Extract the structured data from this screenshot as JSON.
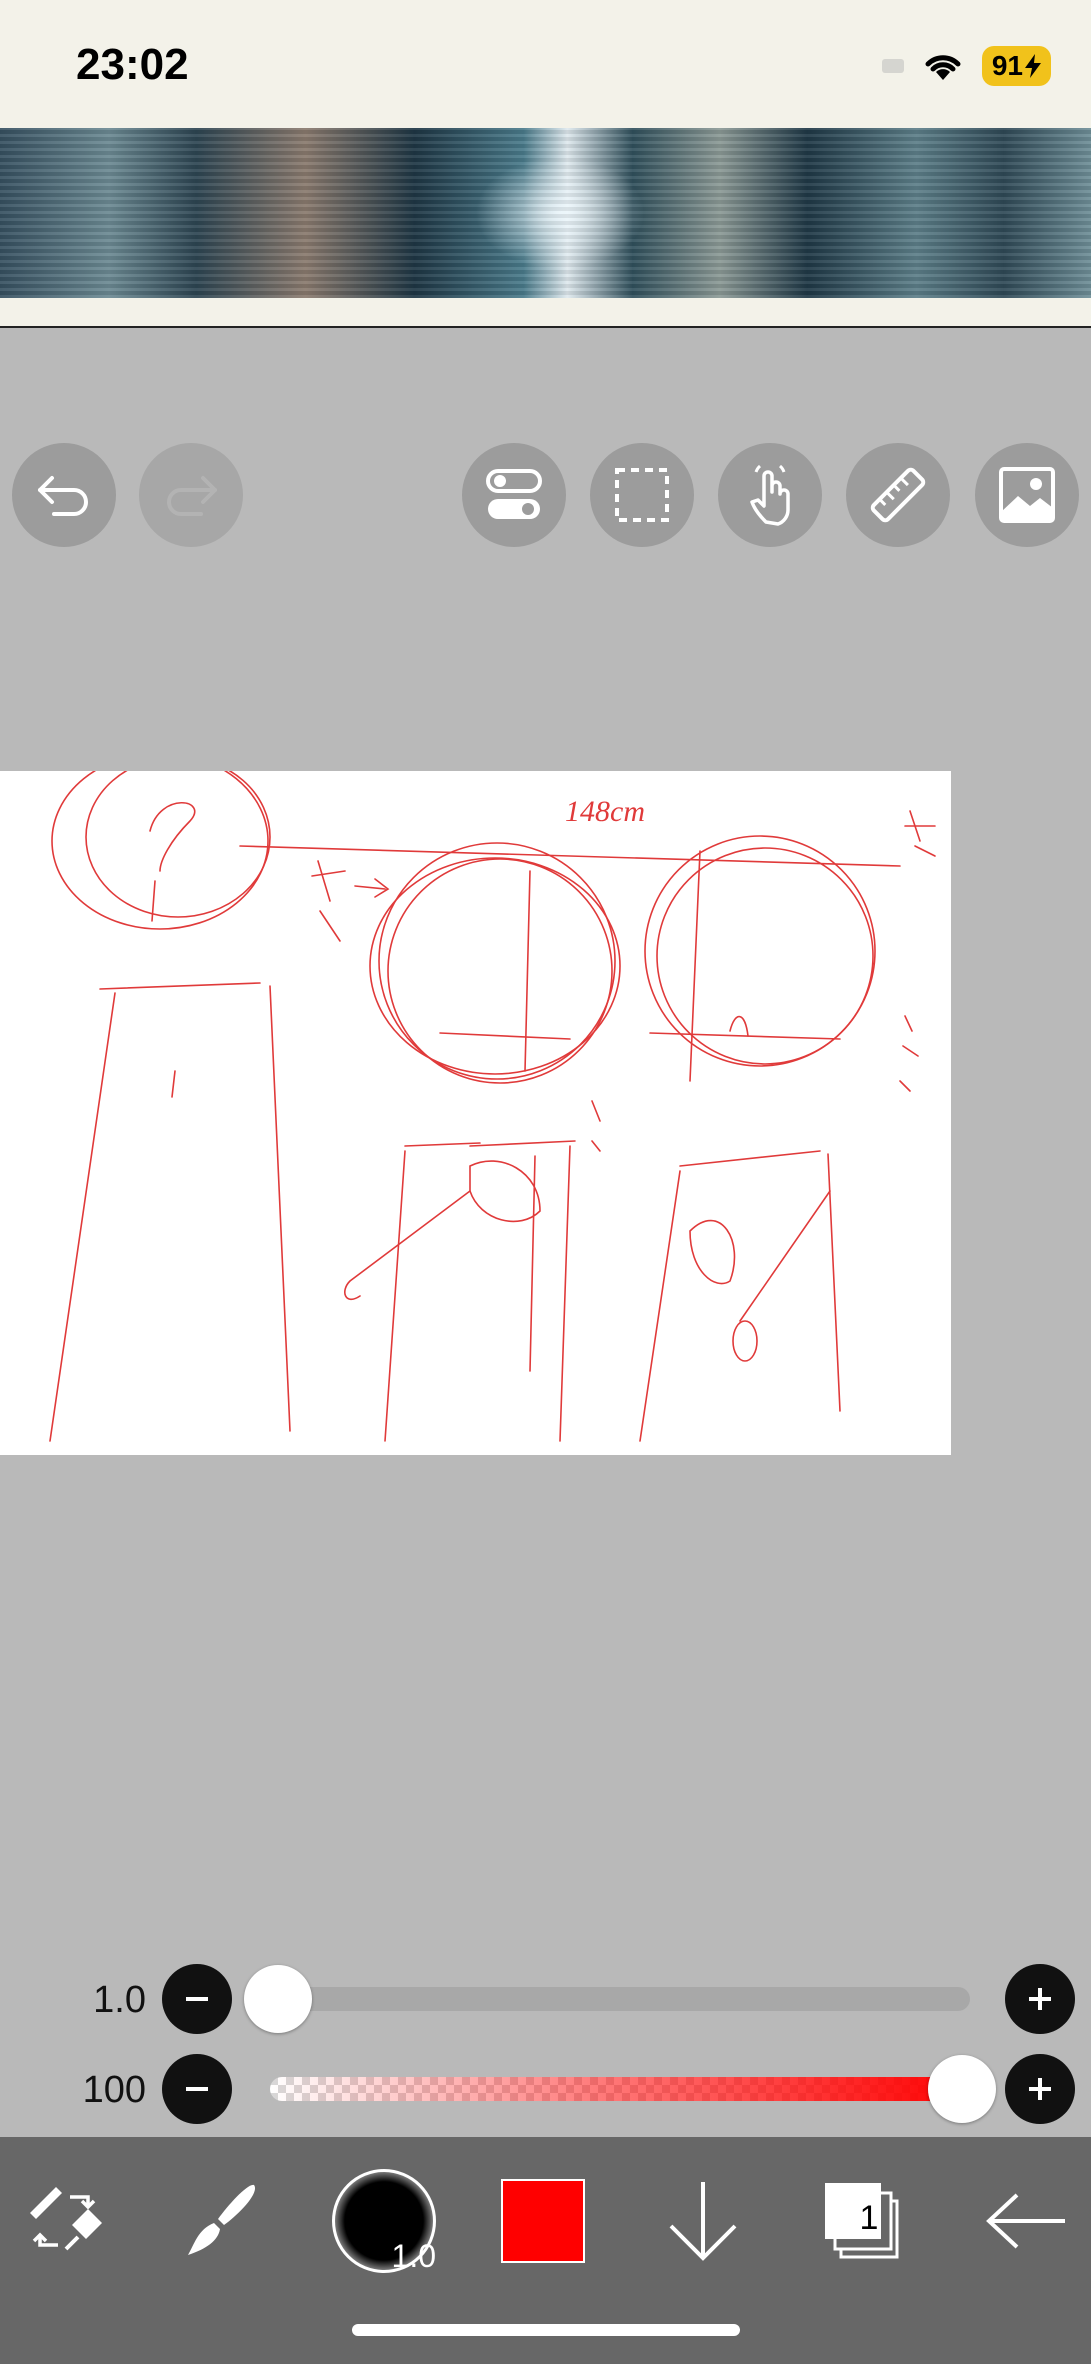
{
  "status_bar": {
    "time": "23:02",
    "battery": "91"
  },
  "top_tools": {
    "undo": "undo-icon",
    "redo": "redo-icon",
    "toggle": "toggle-icon",
    "selection": "selection-icon",
    "gesture": "hand-gesture-icon",
    "ruler": "ruler-icon",
    "image": "image-icon"
  },
  "canvas": {
    "note": "148cm"
  },
  "brush_size": {
    "value": "1.0",
    "level": 0.0
  },
  "opacity": {
    "value": "100",
    "level": 1.0,
    "color": "#ff0000"
  },
  "bottom_toolbar": {
    "brush_size_badge": "1.0",
    "color": "#ff0000",
    "layer_count": "1"
  },
  "colors": {
    "toolbar_bg": "#676767",
    "workspace_bg": "#b9b9b9",
    "sketch": "#e03a3a"
  }
}
